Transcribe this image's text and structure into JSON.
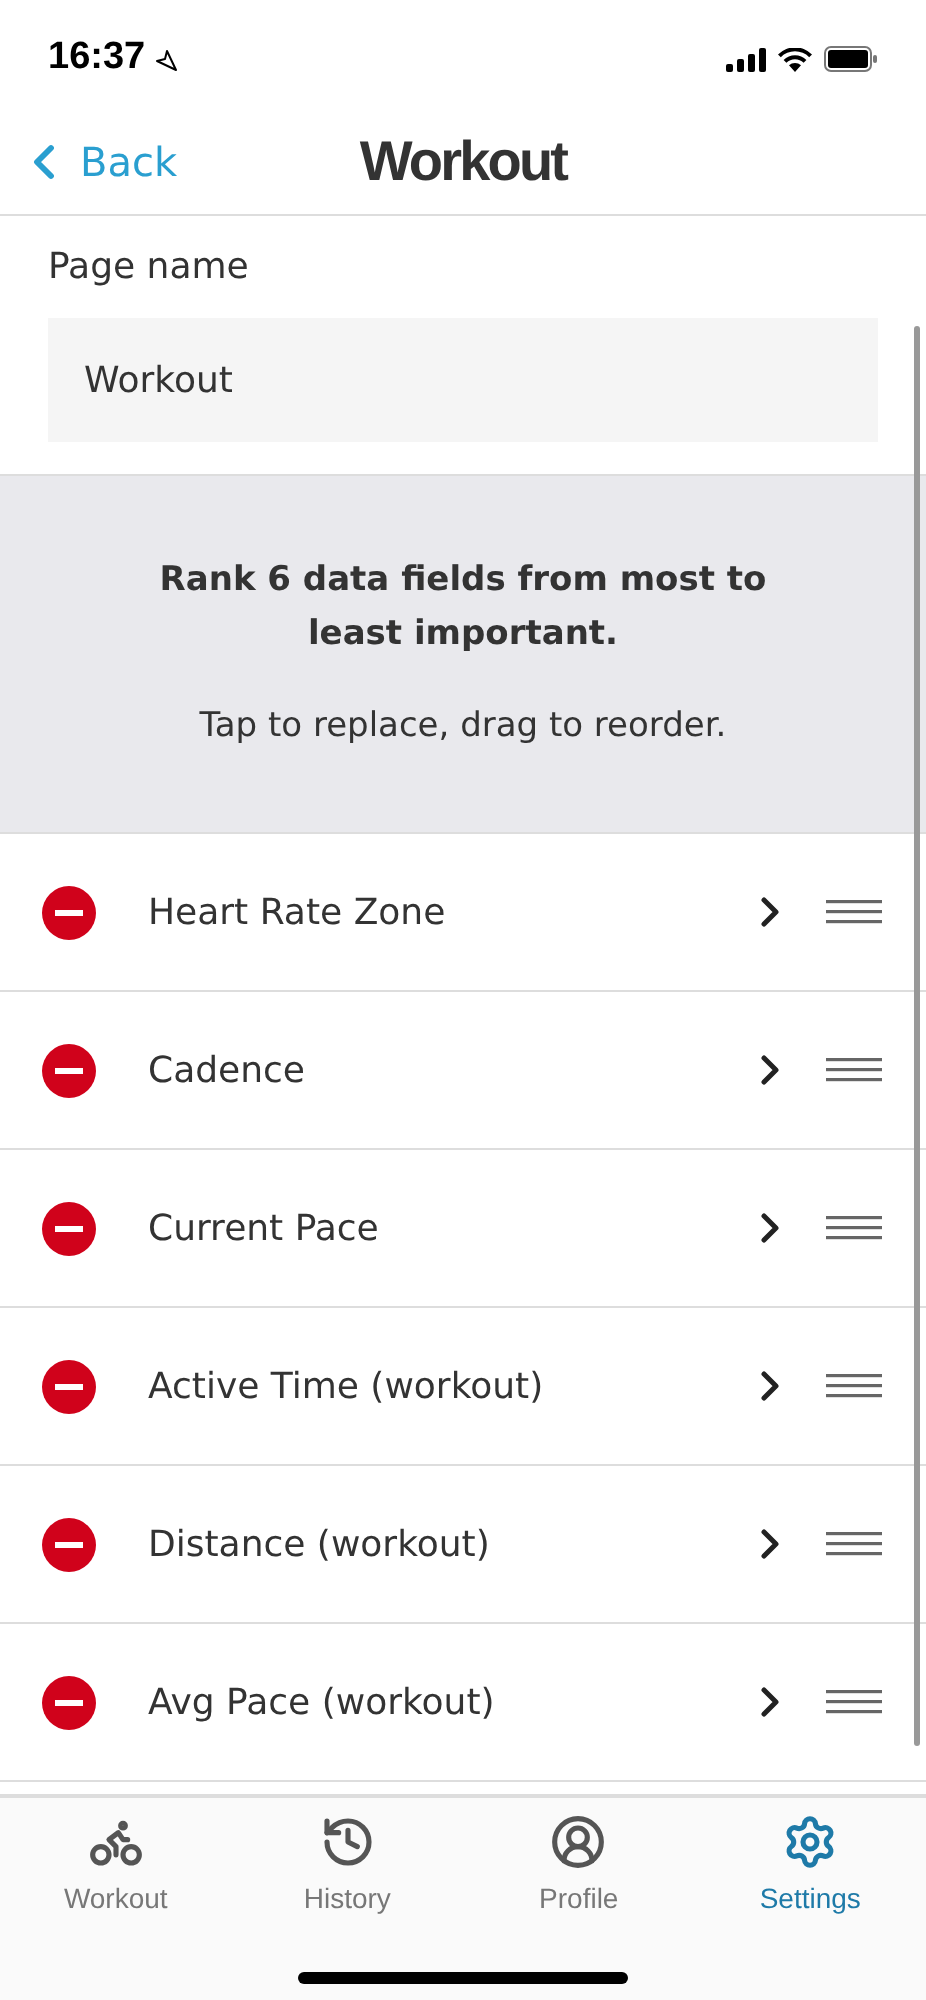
{
  "status_bar": {
    "time": "16:37"
  },
  "nav": {
    "back": "Back",
    "title": "Workout"
  },
  "page_name": {
    "label": "Page name",
    "value": "Workout"
  },
  "info": {
    "heading": "Rank 6 data fields from most to least important.",
    "hint": "Tap to replace, drag to reorder."
  },
  "fields": [
    {
      "name": "Heart Rate Zone"
    },
    {
      "name": "Cadence"
    },
    {
      "name": "Current Pace"
    },
    {
      "name": "Active Time (workout)"
    },
    {
      "name": "Distance (workout)"
    },
    {
      "name": "Avg Pace (workout)"
    }
  ],
  "tabs": [
    {
      "label": "Workout",
      "kind": "bike",
      "selected": false
    },
    {
      "label": "History",
      "kind": "history",
      "selected": false
    },
    {
      "label": "Profile",
      "kind": "profile",
      "selected": false
    },
    {
      "label": "Settings",
      "kind": "settings",
      "selected": true
    }
  ]
}
